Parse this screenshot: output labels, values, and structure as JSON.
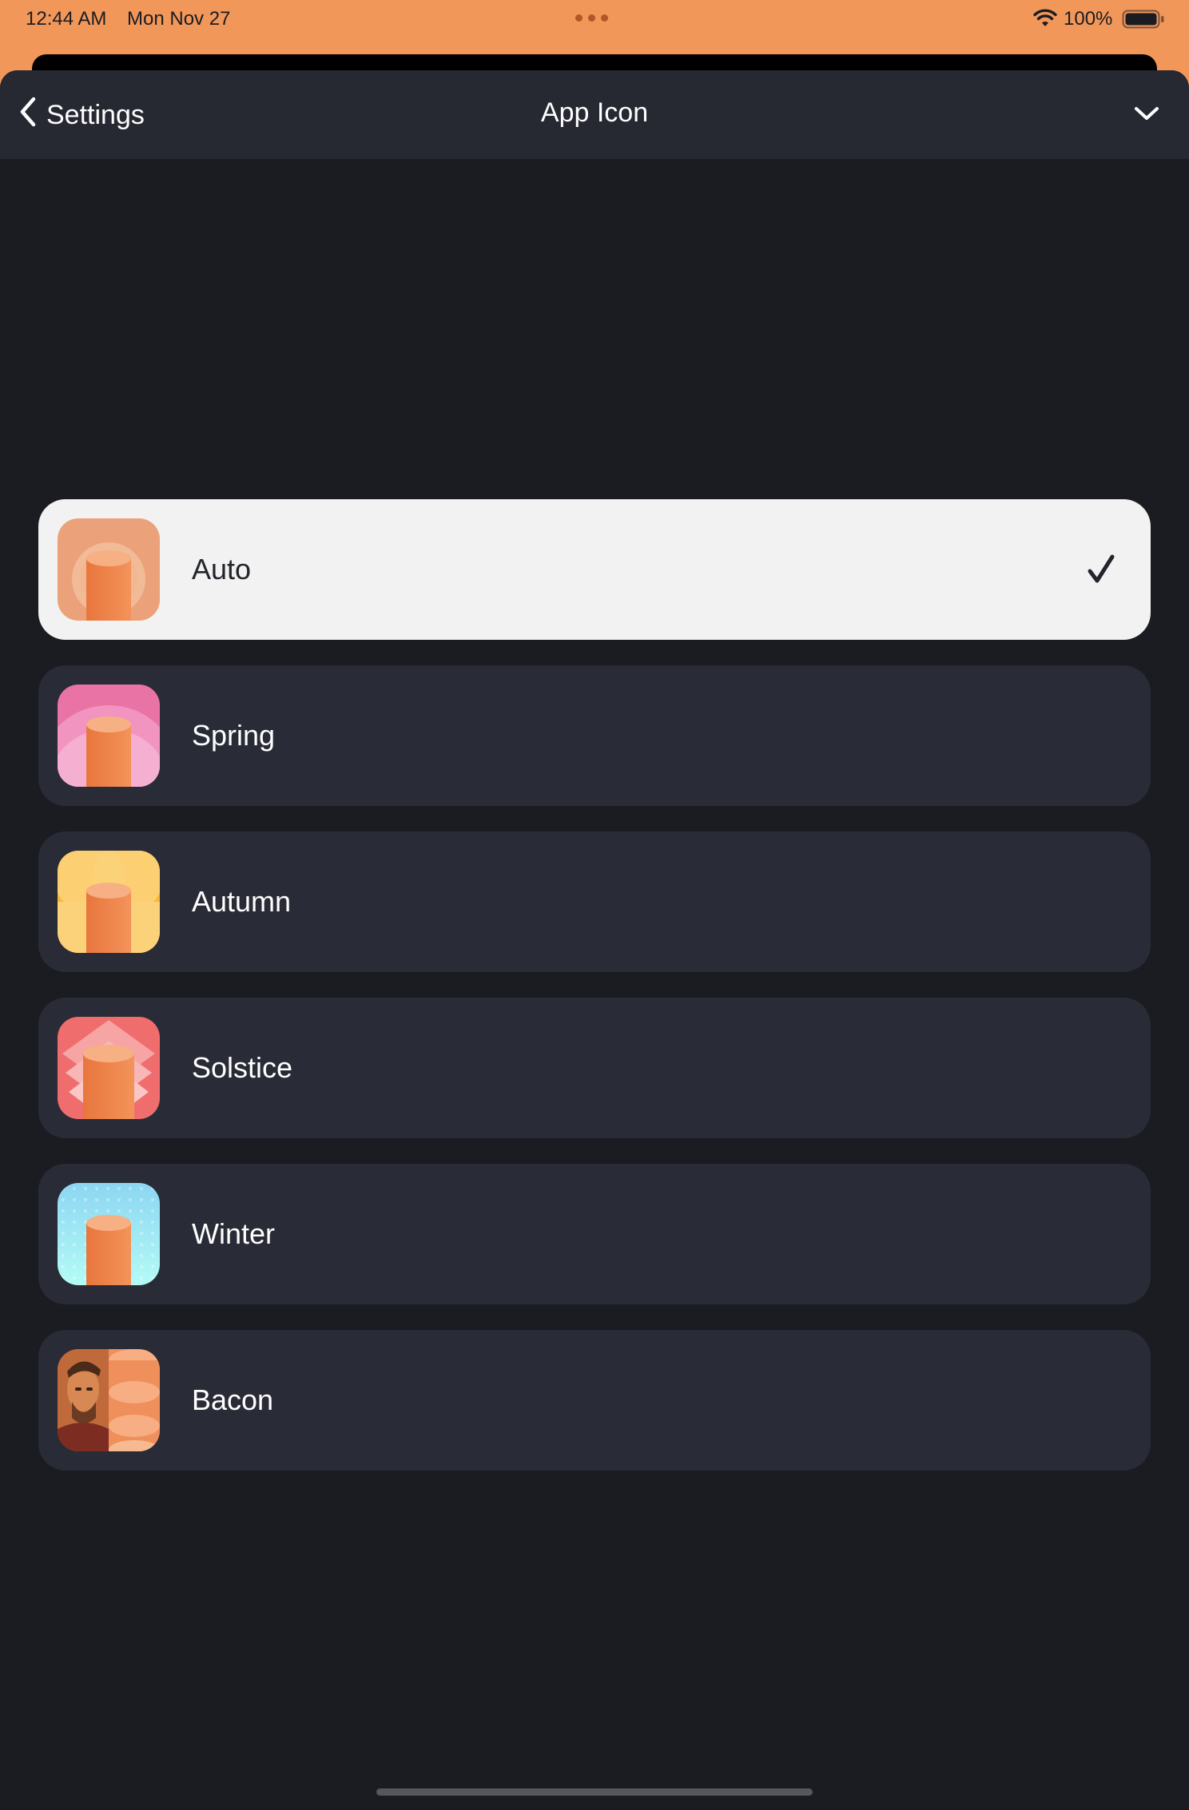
{
  "status_bar": {
    "time": "12:44 AM",
    "date": "Mon Nov 27",
    "battery": "100%"
  },
  "nav": {
    "back_label": "Settings",
    "title": "App Icon"
  },
  "icons": [
    {
      "label": "Auto",
      "selected": true
    },
    {
      "label": "Spring",
      "selected": false
    },
    {
      "label": "Autumn",
      "selected": false
    },
    {
      "label": "Solstice",
      "selected": false
    },
    {
      "label": "Winter",
      "selected": false
    },
    {
      "label": "Bacon",
      "selected": false
    }
  ],
  "colors": {
    "accent": "#f2975a",
    "sheet_background": "#1b1c21",
    "row_background": "#292b37",
    "selected_row_background": "#f2f2f2"
  }
}
